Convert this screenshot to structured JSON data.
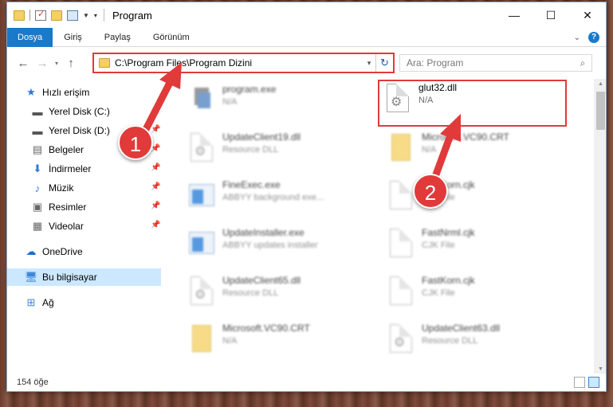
{
  "window": {
    "title": "Program",
    "controls": {
      "minimize": "—",
      "maximize": "☐",
      "close": "✕"
    }
  },
  "ribbon": {
    "tabs": [
      "Dosya",
      "Giriş",
      "Paylaş",
      "Görünüm"
    ]
  },
  "address": {
    "path": "C:\\Program Files\\Program Dizini",
    "search_placeholder": "Ara: Program"
  },
  "navpane": {
    "items": [
      {
        "label": "Hızlı erişim",
        "icon": "star-icon"
      },
      {
        "label": "Yerel Disk (C:)",
        "icon": "drive-icon",
        "pinned": true
      },
      {
        "label": "Yerel Disk (D:)",
        "icon": "drive-icon",
        "pinned": true
      },
      {
        "label": "Belgeler",
        "icon": "documents-icon",
        "pinned": true
      },
      {
        "label": "İndirmeler",
        "icon": "download-icon",
        "pinned": true
      },
      {
        "label": "Müzik",
        "icon": "music-icon",
        "pinned": true
      },
      {
        "label": "Resimler",
        "icon": "pictures-icon",
        "pinned": true
      },
      {
        "label": "Videolar",
        "icon": "videos-icon",
        "pinned": true
      },
      {
        "label": "OneDrive",
        "icon": "cloud-icon"
      },
      {
        "label": "Bu bilgisayar",
        "icon": "computer-icon",
        "selected": true
      },
      {
        "label": "Ağ",
        "icon": "network-icon"
      }
    ]
  },
  "files": [
    {
      "name": "program.exe",
      "sub": "N/A",
      "icon": "exe-icon"
    },
    {
      "name": "glut32.dll",
      "sub": "N/A",
      "icon": "dll-icon",
      "highlighted": true
    },
    {
      "name": "UpdateClient19.dll",
      "sub": "Resource DLL",
      "icon": "dll-icon"
    },
    {
      "name": "Microsoft.VC90.CRT",
      "sub": "N/A",
      "icon": "folder-icon"
    },
    {
      "name": "FineExec.exe",
      "sub": "ABBYY background exe...",
      "icon": "app-icon"
    },
    {
      "name": "FastKorn.cjk",
      "sub": "CJK File",
      "icon": "file-icon"
    },
    {
      "name": "UpdateInstaller.exe",
      "sub": "ABBYY updates installer",
      "icon": "app-icon"
    },
    {
      "name": "FastNrml.cjk",
      "sub": "CJK File",
      "icon": "file-icon"
    },
    {
      "name": "UpdateClient65.dll",
      "sub": "Resource DLL",
      "icon": "dll-icon"
    },
    {
      "name": "FastKorn.cjk",
      "sub": "CJK File",
      "icon": "file-icon"
    },
    {
      "name": "Microsoft.VC90.CRT",
      "sub": "N/A",
      "icon": "folder-icon"
    },
    {
      "name": "UpdateClient63.dll",
      "sub": "Resource DLL",
      "icon": "dll-icon"
    }
  ],
  "status": {
    "count": "154 öğe"
  },
  "annotations": {
    "step1": "1",
    "step2": "2"
  },
  "colors": {
    "accent": "#1979ca",
    "highlight": "#e03a3a",
    "selection": "#cce8ff"
  }
}
